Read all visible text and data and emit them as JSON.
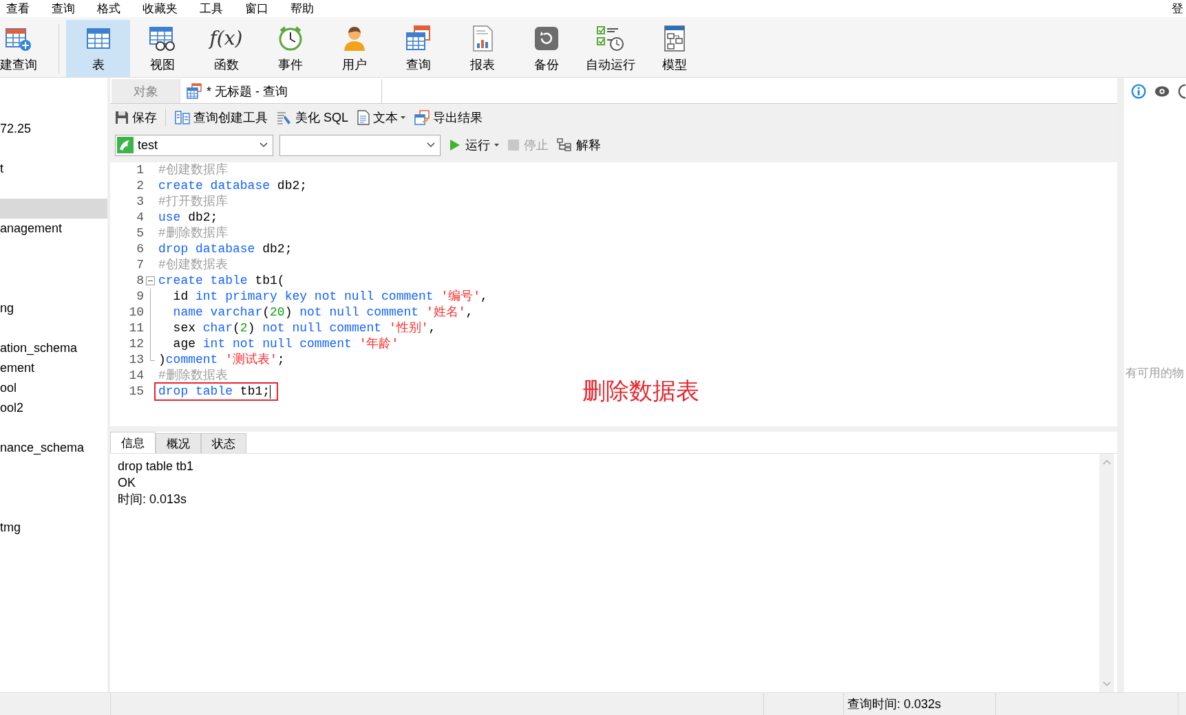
{
  "menu": [
    {
      "label": "查看"
    },
    {
      "label": "查询"
    },
    {
      "label": "格式"
    },
    {
      "label": "收藏夹"
    },
    {
      "label": "工具"
    },
    {
      "label": "窗口"
    },
    {
      "label": "帮助"
    }
  ],
  "login": "登",
  "toolbar": [
    {
      "kind": "new-query",
      "label": "建查询",
      "selected": false
    },
    {
      "kind": "table",
      "label": "表",
      "selected": true
    },
    {
      "kind": "view",
      "label": "视图",
      "selected": false
    },
    {
      "kind": "function",
      "label": "函数",
      "glyph": "f(x)",
      "selected": false
    },
    {
      "kind": "event",
      "label": "事件",
      "selected": false
    },
    {
      "kind": "user",
      "label": "用户",
      "selected": false
    },
    {
      "kind": "query",
      "label": "查询",
      "selected": false
    },
    {
      "kind": "report",
      "label": "报表",
      "selected": false
    },
    {
      "kind": "backup",
      "label": "备份",
      "selected": false
    },
    {
      "kind": "schedule",
      "label": "自动运行",
      "selected": false
    },
    {
      "kind": "model",
      "label": "模型",
      "selected": false
    }
  ],
  "sidebar": {
    "items": [
      {
        "label": "72.25",
        "selected": false
      },
      {
        "selected": false
      },
      {
        "label": "t",
        "selected": false
      },
      {
        "selected": false
      },
      {
        "selected": true
      },
      {
        "label": "anagement",
        "selected": false
      },
      {
        "selected": false
      },
      {
        "selected": false
      },
      {
        "selected": false
      },
      {
        "label": "ng",
        "selected": false
      },
      {
        "selected": false
      },
      {
        "label": "ation_schema",
        "selected": false
      },
      {
        "label": "ement",
        "selected": false
      },
      {
        "label": "ool",
        "selected": false
      },
      {
        "label": "ool2",
        "selected": false
      },
      {
        "selected": false
      },
      {
        "label": "nance_schema",
        "selected": false
      },
      {
        "selected": false
      },
      {
        "selected": false
      },
      {
        "selected": false
      },
      {
        "label": "tmg",
        "selected": false
      }
    ]
  },
  "tabs": [
    {
      "kind": "objects",
      "label": "对象",
      "selected": false
    },
    {
      "kind": "query",
      "label": "* 无标题 - 查询",
      "selected": true
    }
  ],
  "query_toolbar": [
    {
      "kind": "save",
      "label": "保存",
      "dropdown": false
    },
    {
      "kind": "builder",
      "label": "查询创建工具",
      "dropdown": false
    },
    {
      "kind": "beautify",
      "label": "美化 SQL",
      "dropdown": false
    },
    {
      "kind": "text",
      "label": "文本",
      "dropdown": true
    },
    {
      "kind": "export",
      "label": "导出结果",
      "dropdown": false
    }
  ],
  "connection": {
    "value": "test"
  },
  "run_bar": [
    {
      "kind": "run",
      "label": "运行",
      "dropdown": true,
      "disabled": false
    },
    {
      "kind": "stop",
      "label": "停止",
      "dropdown": false,
      "disabled": true
    },
    {
      "kind": "explain",
      "label": "解释",
      "dropdown": false,
      "disabled": false
    }
  ],
  "editor": {
    "annotation": "删除数据表",
    "lines": [
      {
        "number": "1",
        "highlighted": false,
        "kind": "code",
        "tokens": [
          {
            "kind": "comment",
            "text": "#创建数据库"
          }
        ]
      },
      {
        "number": "2",
        "highlighted": false,
        "kind": "code",
        "tokens": [
          {
            "kind": "keyword",
            "text": "create database"
          },
          {
            "kind": "plain",
            "text": " db2;"
          }
        ]
      },
      {
        "number": "3",
        "highlighted": false,
        "kind": "code",
        "tokens": [
          {
            "kind": "comment",
            "text": "#打开数据库"
          }
        ]
      },
      {
        "number": "4",
        "highlighted": false,
        "kind": "code",
        "tokens": [
          {
            "kind": "keyword",
            "text": "use"
          },
          {
            "kind": "plain",
            "text": " db2;"
          }
        ]
      },
      {
        "number": "5",
        "highlighted": false,
        "kind": "code",
        "tokens": [
          {
            "kind": "comment",
            "text": "#删除数据库"
          }
        ]
      },
      {
        "number": "6",
        "highlighted": false,
        "kind": "code",
        "tokens": [
          {
            "kind": "keyword",
            "text": "drop database"
          },
          {
            "kind": "plain",
            "text": " db2;"
          }
        ]
      },
      {
        "number": "7",
        "highlighted": false,
        "kind": "code",
        "tokens": [
          {
            "kind": "comment",
            "text": "#创建数据表"
          }
        ]
      },
      {
        "number": "8",
        "highlighted": false,
        "kind": "fold-start",
        "tokens": [
          {
            "kind": "keyword",
            "text": "create table"
          },
          {
            "kind": "plain",
            "text": " tb1("
          }
        ]
      },
      {
        "number": "9",
        "highlighted": false,
        "kind": "fold-inside",
        "tokens": [
          {
            "kind": "plain",
            "text": "  id "
          },
          {
            "kind": "keyword",
            "text": "int primary key not null comment "
          },
          {
            "kind": "string",
            "text": "'编号'"
          },
          {
            "kind": "plain",
            "text": ","
          }
        ]
      },
      {
        "number": "10",
        "highlighted": false,
        "kind": "fold-inside",
        "tokens": [
          {
            "kind": "keyword",
            "text": "  name varchar"
          },
          {
            "kind": "plain",
            "text": "("
          },
          {
            "kind": "number",
            "text": "20"
          },
          {
            "kind": "plain",
            "text": ") "
          },
          {
            "kind": "keyword",
            "text": "not null comment "
          },
          {
            "kind": "string",
            "text": "'姓名'"
          },
          {
            "kind": "plain",
            "text": ","
          }
        ]
      },
      {
        "number": "11",
        "highlighted": false,
        "kind": "fold-inside",
        "tokens": [
          {
            "kind": "plain",
            "text": "  sex "
          },
          {
            "kind": "keyword",
            "text": "char"
          },
          {
            "kind": "plain",
            "text": "("
          },
          {
            "kind": "number",
            "text": "2"
          },
          {
            "kind": "plain",
            "text": ") "
          },
          {
            "kind": "keyword",
            "text": "not null comment "
          },
          {
            "kind": "string",
            "text": "'性别'"
          },
          {
            "kind": "plain",
            "text": ","
          }
        ]
      },
      {
        "number": "12",
        "highlighted": false,
        "kind": "fold-inside",
        "tokens": [
          {
            "kind": "plain",
            "text": "  age "
          },
          {
            "kind": "keyword",
            "text": "int not null comment "
          },
          {
            "kind": "string",
            "text": "'年龄'"
          }
        ]
      },
      {
        "number": "13",
        "highlighted": false,
        "kind": "fold-end",
        "tokens": [
          {
            "kind": "plain",
            "text": ")"
          },
          {
            "kind": "keyword",
            "text": "comment "
          },
          {
            "kind": "string",
            "text": "'测试表'"
          },
          {
            "kind": "plain",
            "text": ";"
          }
        ]
      },
      {
        "number": "14",
        "highlighted": false,
        "kind": "code",
        "tokens": [
          {
            "kind": "comment",
            "text": "#删除数据表"
          }
        ]
      },
      {
        "number": "15",
        "highlighted": true,
        "kind": "code",
        "tokens": [
          {
            "kind": "keyword",
            "text": "drop table"
          },
          {
            "kind": "plain",
            "text": " tb1;"
          }
        ]
      }
    ]
  },
  "right_panel": {
    "hint": "有可用的物"
  },
  "result_tabs": [
    {
      "label": "信息",
      "selected": true
    },
    {
      "label": "概况",
      "selected": false
    },
    {
      "label": "状态",
      "selected": false
    }
  ],
  "messages": [
    "drop table tb1",
    "OK",
    "时间: 0.013s"
  ],
  "status_bar": {
    "query_time": "查询时间: 0.032s"
  }
}
